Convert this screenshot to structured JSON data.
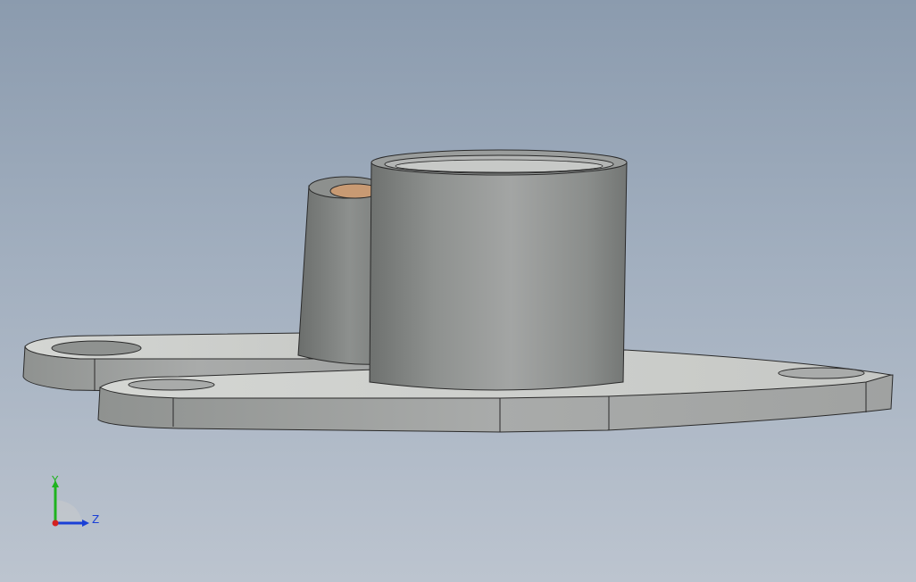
{
  "viewport": {
    "background_top": "#8b9bae",
    "background_bottom": "#bcc4cf"
  },
  "model": {
    "part_color": "#9a9d9c",
    "bushing_color": "#c89a73"
  },
  "triad": {
    "y_label": "Y",
    "z_label": "Z",
    "y_color": "#1fb31f",
    "z_color": "#1a3fd6",
    "x_color": "#d42020"
  }
}
